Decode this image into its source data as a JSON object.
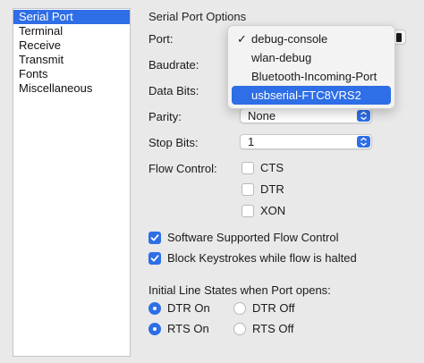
{
  "sidebar": {
    "items": [
      {
        "label": "Serial Port",
        "selected": true
      },
      {
        "label": "Terminal",
        "selected": false
      },
      {
        "label": "Receive",
        "selected": false
      },
      {
        "label": "Transmit",
        "selected": false
      },
      {
        "label": "Fonts",
        "selected": false
      },
      {
        "label": "Miscellaneous",
        "selected": false
      }
    ]
  },
  "panel": {
    "title": "Serial Port Options",
    "port_label": "Port:",
    "baudrate_label": "Baudrate:",
    "databits_label": "Data Bits:",
    "parity_label": "Parity:",
    "parity_value": "None",
    "stopbits_label": "Stop Bits:",
    "stopbits_value": "1",
    "flow_label": "Flow Control:",
    "flow_options": [
      {
        "label": "CTS",
        "checked": false
      },
      {
        "label": "DTR",
        "checked": false
      },
      {
        "label": "XON",
        "checked": false
      }
    ],
    "software_flow": {
      "label": "Software Supported Flow Control",
      "checked": true
    },
    "block_keystrokes": {
      "label": "Block Keystrokes while flow is halted",
      "checked": true
    },
    "line_states_label": "Initial Line States when Port opens:",
    "line_states": {
      "dtr_on": {
        "label": "DTR On",
        "selected": true
      },
      "dtr_off": {
        "label": "DTR Off",
        "selected": false
      },
      "rts_on": {
        "label": "RTS On",
        "selected": true
      },
      "rts_off": {
        "label": "RTS Off",
        "selected": false
      }
    }
  },
  "port_menu": {
    "checkmark": "✓",
    "items": [
      {
        "label": "debug-console",
        "checked": true,
        "highlighted": false
      },
      {
        "label": "wlan-debug",
        "checked": false,
        "highlighted": false
      },
      {
        "label": "Bluetooth-Incoming-Port",
        "checked": false,
        "highlighted": false
      },
      {
        "label": "usbserial-FTC8VRS2",
        "checked": false,
        "highlighted": true
      }
    ]
  },
  "colors": {
    "accent": "#2e6ee6",
    "background": "#e9e9e9"
  }
}
